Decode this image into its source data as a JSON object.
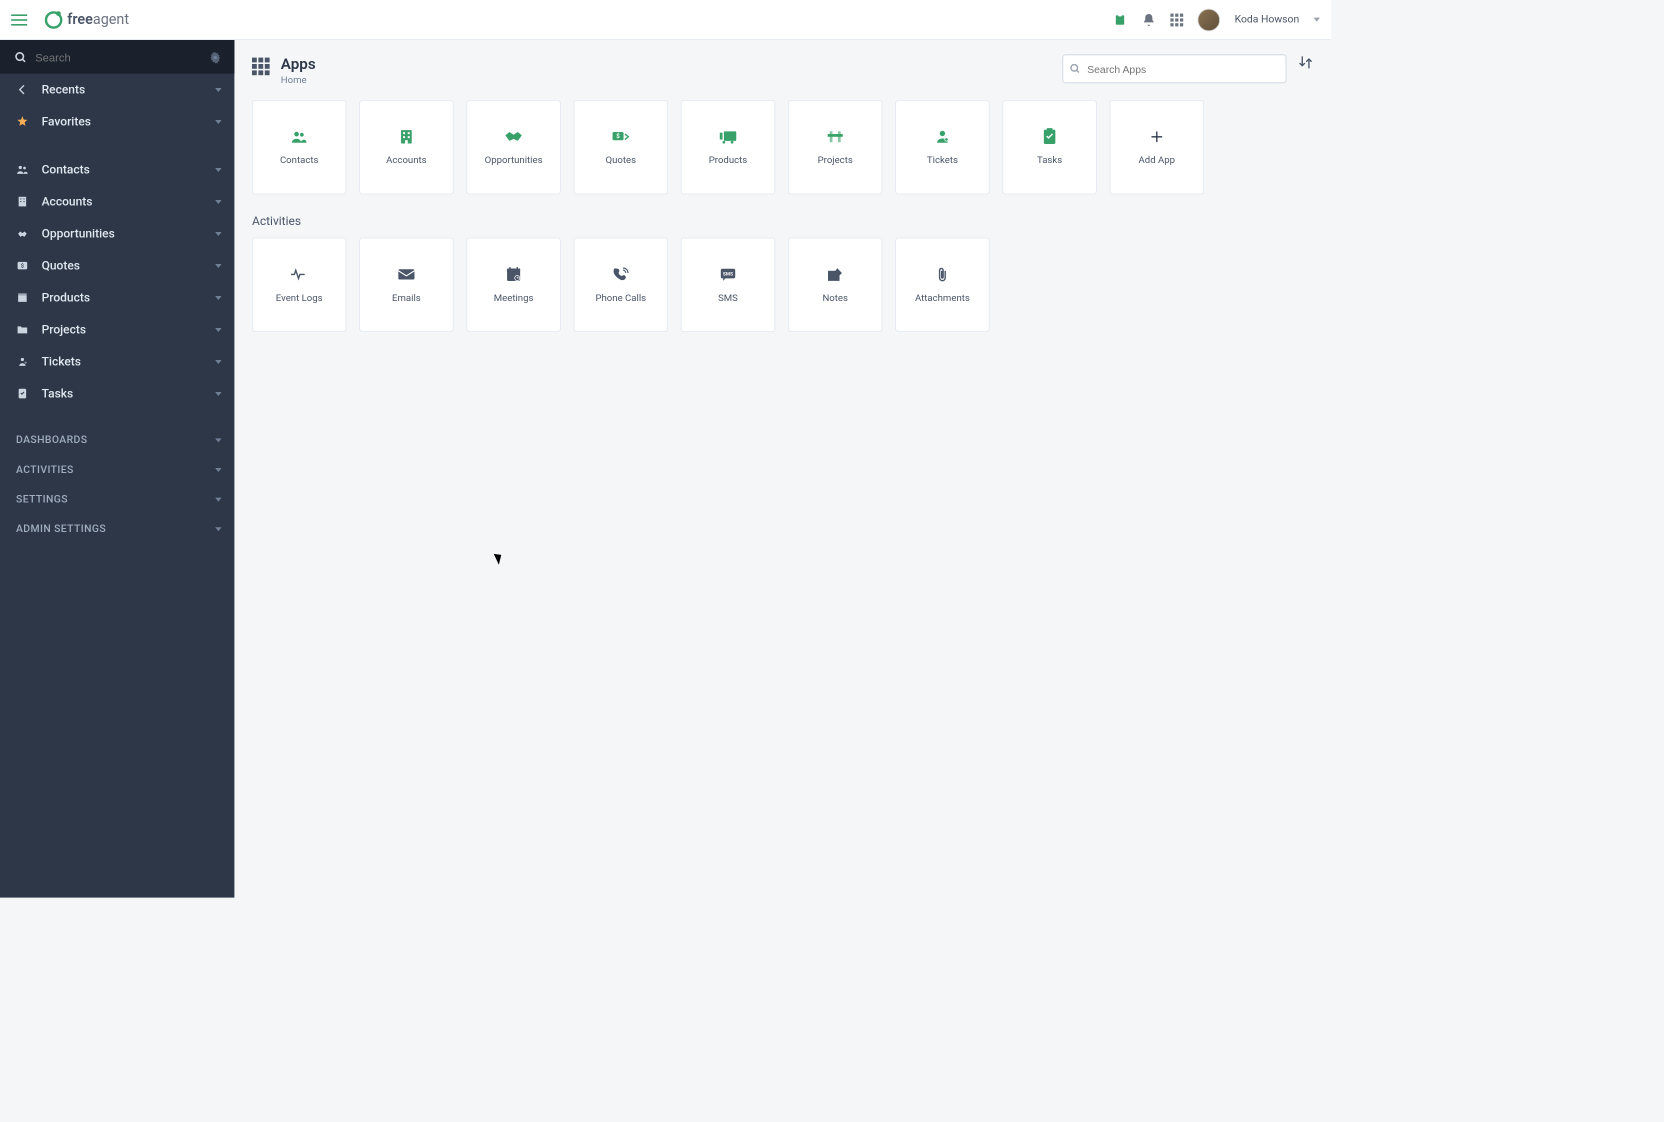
{
  "brand": {
    "name": "freeagent",
    "bold_part": "free"
  },
  "user": {
    "name": "Koda Howson"
  },
  "sidebar": {
    "search_placeholder": "Search",
    "top_items": [
      {
        "label": "Recents",
        "icon": "arrow-left"
      },
      {
        "label": "Favorites",
        "icon": "star"
      }
    ],
    "nav_items": [
      {
        "label": "Contacts",
        "icon": "people"
      },
      {
        "label": "Accounts",
        "icon": "building"
      },
      {
        "label": "Opportunities",
        "icon": "handshake"
      },
      {
        "label": "Quotes",
        "icon": "dollar"
      },
      {
        "label": "Products",
        "icon": "box"
      },
      {
        "label": "Projects",
        "icon": "folder"
      },
      {
        "label": "Tickets",
        "icon": "ticket"
      },
      {
        "label": "Tasks",
        "icon": "checklist"
      }
    ],
    "bottom_items": [
      {
        "label": "DASHBOARDS"
      },
      {
        "label": "ACTIVITIES"
      },
      {
        "label": "SETTINGS"
      },
      {
        "label": "ADMIN SETTINGS"
      }
    ]
  },
  "main": {
    "title": "Apps",
    "breadcrumb": "Home",
    "search_placeholder": "Search Apps",
    "apps": [
      {
        "label": "Contacts"
      },
      {
        "label": "Accounts"
      },
      {
        "label": "Opportunities"
      },
      {
        "label": "Quotes"
      },
      {
        "label": "Products"
      },
      {
        "label": "Projects"
      },
      {
        "label": "Tickets"
      },
      {
        "label": "Tasks"
      },
      {
        "label": "Add App",
        "is_add": true
      }
    ],
    "activities_label": "Activities",
    "activities": [
      {
        "label": "Event Logs"
      },
      {
        "label": "Emails"
      },
      {
        "label": "Meetings"
      },
      {
        "label": "Phone Calls"
      },
      {
        "label": "SMS"
      },
      {
        "label": "Notes"
      },
      {
        "label": "Attachments"
      }
    ]
  }
}
